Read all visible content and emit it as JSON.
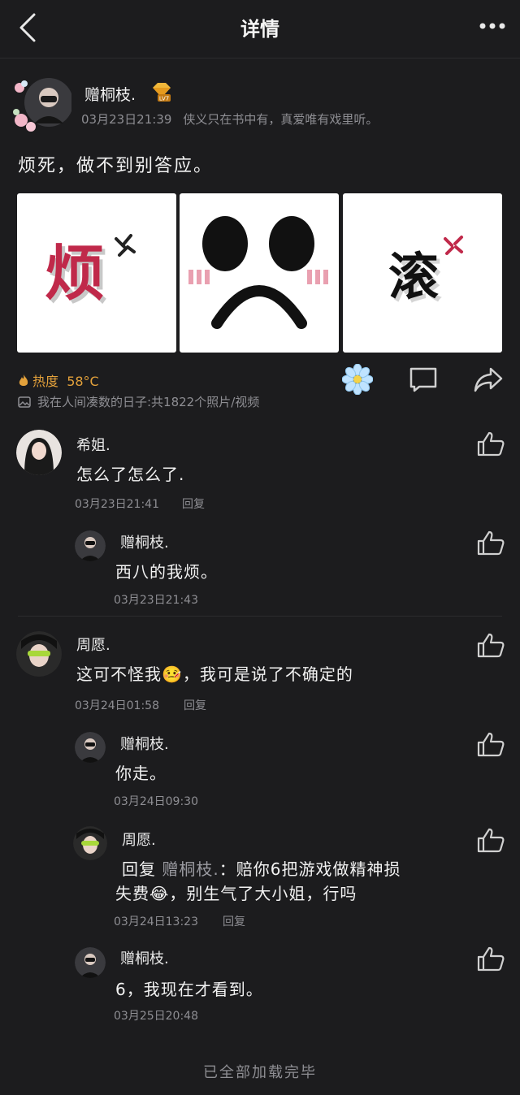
{
  "header": {
    "title": "详情"
  },
  "post": {
    "author": "赠桐枝.",
    "vip_badge": "LV7",
    "time": "03月23日21:39",
    "signature": "侠义只在书中有，真爱唯有戏里听。",
    "text": "烦死，做不到别答应。",
    "images": [
      {
        "caption": "烦",
        "accent": "#c0294a"
      },
      {
        "caption": "sad-face",
        "accent": "#000000"
      },
      {
        "caption": "滚",
        "accent": "#c0294a"
      }
    ],
    "heat_label": "热度",
    "heat_value": "58°C",
    "album_text": "我在人间凑数的日子:共1822个照片/视频"
  },
  "comments": [
    {
      "name": "希姐.",
      "text": "怎么了怎么了.",
      "time": "03月23日21:41",
      "reply_label": "回复"
    },
    {
      "name": "赠桐枝.",
      "text": "西八的我烦。",
      "time": "03月23日21:43"
    },
    {
      "name": "周愿.",
      "text_before": "这可不怪我",
      "emoji": "🤒",
      "text_after": "，我可是说了不确定的",
      "time": "03月24日01:58",
      "reply_label": "回复"
    },
    {
      "name": "赠桐枝.",
      "text": "你走。",
      "time": "03月24日09:30"
    },
    {
      "name": "周愿.",
      "reply_prefix": "回复",
      "reply_target": "赠桐枝.",
      "line1": "：赔你6把游戏做精神损",
      "line2_before": "失费",
      "emoji": "😂",
      "line2_after": "，别生气了大小姐，行吗",
      "time": "03月24日13:23",
      "reply_label": "回复"
    },
    {
      "name": "赠桐枝.",
      "text": "6，我现在才看到。",
      "time": "03月25日20:48"
    }
  ],
  "footer": {
    "text": "已全部加载完毕"
  },
  "colors": {
    "background": "#1c1c1e",
    "heat": "#e3a13b",
    "muted": "#8e8e93",
    "flower": "#bfe3ff"
  }
}
